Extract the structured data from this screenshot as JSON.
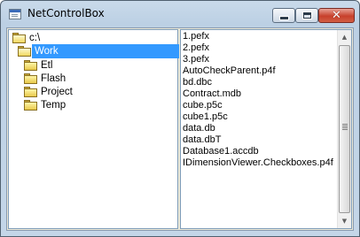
{
  "window": {
    "title": "NetControlBox"
  },
  "title_buttons": {
    "minimize": "minimize",
    "maximize": "maximize",
    "close": "close"
  },
  "tree": {
    "root": {
      "label": "c:\\",
      "icon": "folder-open-icon"
    },
    "selected": {
      "label": "Work",
      "icon": "folder-open-icon"
    },
    "children": [
      {
        "label": "Etl",
        "icon": "folder-icon"
      },
      {
        "label": "Flash",
        "icon": "folder-icon"
      },
      {
        "label": "Project",
        "icon": "folder-icon"
      },
      {
        "label": "Temp",
        "icon": "folder-icon"
      }
    ]
  },
  "files": [
    "1.pefx",
    "2.pefx",
    "3.pefx",
    "AutoCheckParent.p4f",
    "bd.dbc",
    "Contract.mdb",
    "cube.p5c",
    "cube1.p5c",
    "data.db",
    "data.dbT",
    "Database1.accdb",
    "IDimensionViewer.Checkboxes.p4f"
  ],
  "colors": {
    "selection": "#3399ff",
    "close_button": "#c7402c",
    "folder": "#f0d760"
  }
}
